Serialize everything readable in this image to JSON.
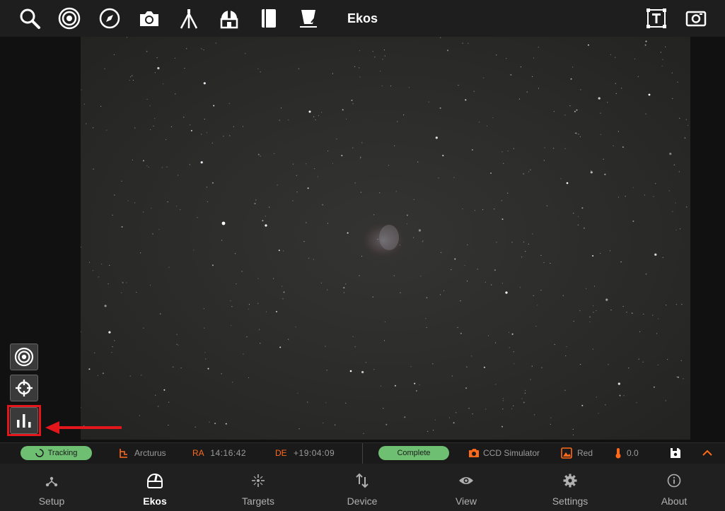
{
  "toolbar": {
    "title": "Ekos",
    "icons": [
      "search-icon",
      "target-icon",
      "compass-icon",
      "camera-icon",
      "tripod-icon",
      "observatory-icon",
      "notebook-icon",
      "lamp-flat-icon",
      "text-frame-icon",
      "screenshot-icon"
    ]
  },
  "side_buttons": [
    "target-button",
    "crosshair-button",
    "histogram-button"
  ],
  "status": {
    "mount_state": "Tracking",
    "target": "Arcturus",
    "ra_label": "RA",
    "ra_value": "14:16:42",
    "de_label": "DE",
    "de_value": "+19:04:09",
    "capture_state": "Complete",
    "camera": "CCD Simulator",
    "filter": "Red",
    "temperature": "0.0"
  },
  "nav": {
    "items": [
      {
        "label": "Setup",
        "icon": "network-icon"
      },
      {
        "label": "Ekos",
        "icon": "observatory-dome-icon",
        "active": true
      },
      {
        "label": "Targets",
        "icon": "star-target-icon"
      },
      {
        "label": "Device",
        "icon": "transfer-icon"
      },
      {
        "label": "View",
        "icon": "eye-icon"
      },
      {
        "label": "Settings",
        "icon": "gear-icon"
      },
      {
        "label": "About",
        "icon": "info-icon"
      }
    ]
  },
  "colors": {
    "accent": "#ff6a1a",
    "status_ok": "#6fbf73",
    "highlight": "#e3161b",
    "toolbar_bg": "#1e1e1e"
  }
}
